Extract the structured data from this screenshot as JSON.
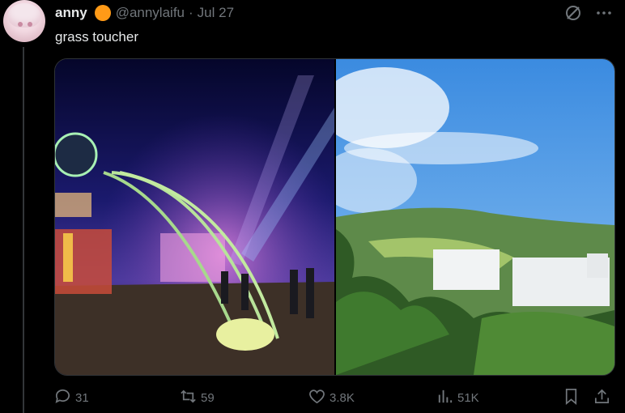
{
  "tweet": {
    "display_name": "anny",
    "emoji": "🍊",
    "handle": "@annylaifu",
    "separator": "·",
    "date": "Jul 27",
    "text": "grass toucher"
  },
  "images": [
    {
      "subject": "night festival with illuminated arch sculpture"
    },
    {
      "subject": "green mountain under blue sky with white buildings"
    }
  ],
  "actions": {
    "replies": "31",
    "reposts": "59",
    "likes": "3.8K",
    "views": "51K"
  },
  "icons": {
    "more": "more-icon",
    "grok": "grok-icon",
    "reply": "reply-icon",
    "repost": "repost-icon",
    "like": "like-icon",
    "views": "views-icon",
    "bookmark": "bookmark-icon",
    "share": "share-icon"
  },
  "colors": {
    "background": "#000000",
    "text": "#e7e9ea",
    "muted": "#71767b",
    "border": "#2f3336"
  }
}
